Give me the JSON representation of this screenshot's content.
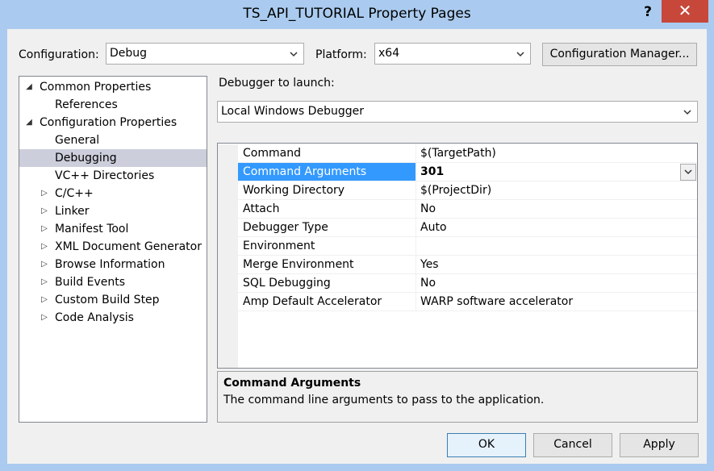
{
  "window": {
    "title": "TS_API_TUTORIAL Property Pages",
    "help_glyph": "?",
    "close_glyph": "✕"
  },
  "toolbar": {
    "configuration_label": "Configuration:",
    "configuration_value": "Debug",
    "platform_label": "Platform:",
    "platform_value": "x64",
    "config_manager_label": "Configuration Manager..."
  },
  "tree": {
    "items": [
      {
        "label": "Common Properties",
        "expander": "◢",
        "level": 0
      },
      {
        "label": "References",
        "expander": "",
        "level": 1
      },
      {
        "label": "Configuration Properties",
        "expander": "◢",
        "level": 0
      },
      {
        "label": "General",
        "expander": "",
        "level": 1
      },
      {
        "label": "Debugging",
        "expander": "",
        "level": 1,
        "selected": true
      },
      {
        "label": "VC++ Directories",
        "expander": "",
        "level": 1
      },
      {
        "label": "C/C++",
        "expander": "▷",
        "level": 1
      },
      {
        "label": "Linker",
        "expander": "▷",
        "level": 1
      },
      {
        "label": "Manifest Tool",
        "expander": "▷",
        "level": 1
      },
      {
        "label": "XML Document Generator",
        "expander": "▷",
        "level": 1
      },
      {
        "label": "Browse Information",
        "expander": "▷",
        "level": 1
      },
      {
        "label": "Build Events",
        "expander": "▷",
        "level": 1
      },
      {
        "label": "Custom Build Step",
        "expander": "▷",
        "level": 1
      },
      {
        "label": "Code Analysis",
        "expander": "▷",
        "level": 1
      }
    ]
  },
  "debugger": {
    "label": "Debugger to launch:",
    "value": "Local Windows Debugger"
  },
  "grid": {
    "rows": [
      {
        "name": "Command",
        "value": "$(TargetPath)"
      },
      {
        "name": "Command Arguments",
        "value": "301",
        "selected": true
      },
      {
        "name": "Working Directory",
        "value": "$(ProjectDir)"
      },
      {
        "name": "Attach",
        "value": "No"
      },
      {
        "name": "Debugger Type",
        "value": "Auto"
      },
      {
        "name": "Environment",
        "value": ""
      },
      {
        "name": "Merge Environment",
        "value": "Yes"
      },
      {
        "name": "SQL Debugging",
        "value": "No"
      },
      {
        "name": "Amp Default Accelerator",
        "value": "WARP software accelerator"
      }
    ]
  },
  "description": {
    "title": "Command Arguments",
    "text": "The command line arguments to pass to the application."
  },
  "buttons": {
    "ok": "OK",
    "cancel": "Cancel",
    "apply": "Apply"
  },
  "colors": {
    "selection_blue": "#3399ff",
    "tree_selection": "#cccedb",
    "close_red": "#c7473b",
    "frame": "#aacbef"
  }
}
